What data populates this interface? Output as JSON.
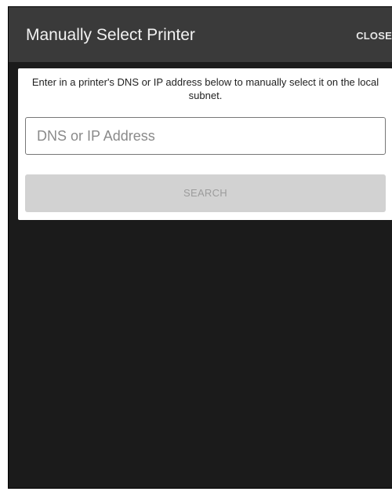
{
  "header": {
    "title": "Manually Select Printer",
    "close_label": "CLOSE"
  },
  "dialog": {
    "instructions": "Enter in a printer's DNS or IP address below to manually select it on the local subnet.",
    "address_input": {
      "value": "",
      "placeholder": "DNS or IP Address"
    },
    "search_label": "SEARCH",
    "search_enabled": false
  },
  "colors": {
    "screen_background": "#1b1b1b",
    "app_bar": "#3a3a3a",
    "card": "#ffffff",
    "disabled_button": "#d2d2d2",
    "disabled_button_text": "#9c9c9c"
  }
}
